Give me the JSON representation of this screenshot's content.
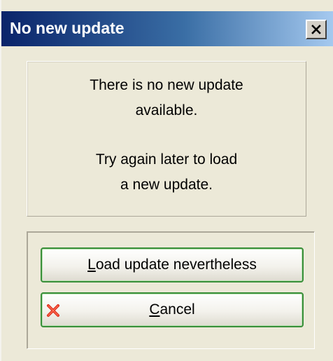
{
  "window": {
    "title": "No new update"
  },
  "message": {
    "line1": "There is no new update",
    "line2": "available.",
    "line3": "Try again later to load",
    "line4": "a new update."
  },
  "buttons": {
    "load": {
      "mnemonic": "L",
      "rest": "oad update nevertheless"
    },
    "cancel": {
      "mnemonic": "C",
      "rest": "ancel",
      "icon": "red-x-icon"
    }
  },
  "colors": {
    "title_gradient_start": "#0a246a",
    "title_gradient_end": "#a6caf0",
    "button_border": "#3a8f3a",
    "cancel_icon": "#e0301e"
  }
}
